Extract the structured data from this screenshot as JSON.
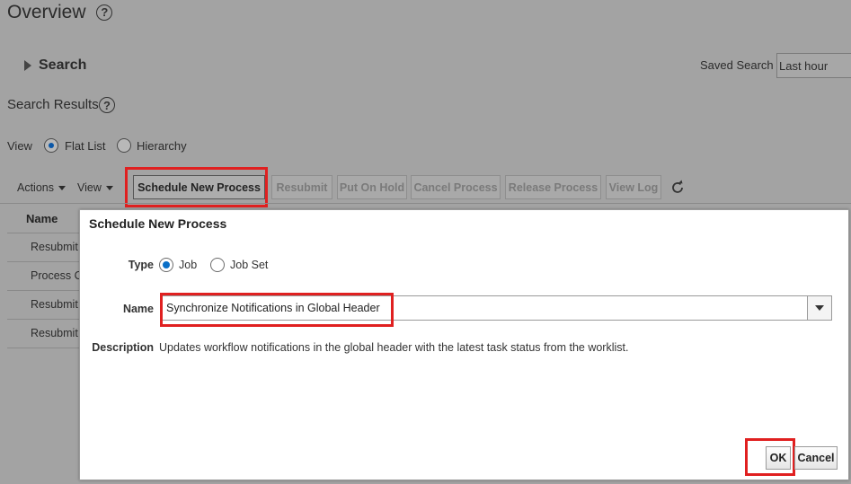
{
  "page": {
    "title": "Overview",
    "help_glyph": "?"
  },
  "search": {
    "label": "Search",
    "saved_search_label": "Saved Search",
    "saved_search_value": "Last hour"
  },
  "results": {
    "label": "Search Results",
    "view_label": "View",
    "view_options": [
      "Flat List",
      "Hierarchy"
    ],
    "view_selected": "Flat List"
  },
  "toolbar": {
    "actions_label": "Actions",
    "view_menu_label": "View",
    "schedule_label": "Schedule New Process",
    "resubmit_label": "Resubmit",
    "put_on_hold_label": "Put On Hold",
    "cancel_process_label": "Cancel Process",
    "release_process_label": "Release Process",
    "view_log_label": "View Log",
    "refresh_icon": "refresh-icon"
  },
  "table": {
    "header_name": "Name",
    "rows": [
      "Resubmit",
      "Process C",
      "Resubmit",
      "Resubmit"
    ]
  },
  "dialog": {
    "title": "Schedule New Process",
    "type_label": "Type",
    "type_options": [
      "Job",
      "Job Set"
    ],
    "type_selected": "Job",
    "name_label": "Name",
    "name_value": "Synchronize Notifications in Global Header",
    "description_label": "Description",
    "description_value": "Updates workflow notifications in the global header with the latest task status from the worklist.",
    "ok_label": "OK",
    "cancel_label": "Cancel"
  },
  "colors": {
    "overlay_gray": "#a3a3a3",
    "highlight_red": "#e02020",
    "radio_blue": "#0a6fc7"
  }
}
